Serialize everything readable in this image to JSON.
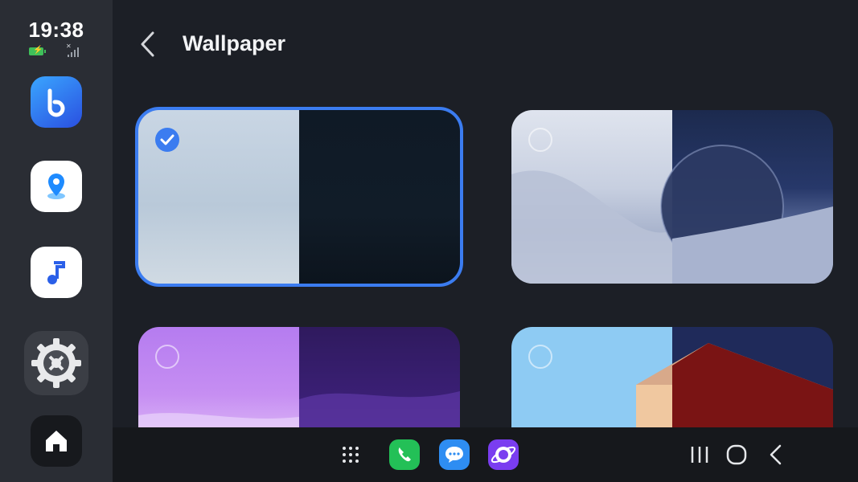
{
  "status_bar": {
    "time": "19:38"
  },
  "rail": {
    "apps": [
      {
        "name": "Bixby",
        "icon": "bixby-icon"
      },
      {
        "name": "Maps",
        "icon": "map-pin-icon"
      },
      {
        "name": "Music",
        "icon": "music-note-icon"
      },
      {
        "name": "Settings",
        "icon": "gear-icon"
      },
      {
        "name": "Home",
        "icon": "home-icon"
      }
    ]
  },
  "header": {
    "title": "Wallpaper",
    "back_icon": "chevron-left-icon"
  },
  "wallpapers": [
    {
      "selected": true
    },
    {
      "selected": false
    },
    {
      "selected": false
    },
    {
      "selected": false
    }
  ],
  "dock": {
    "left_icons": [
      "app-grid-icon",
      "phone-icon",
      "messages-icon",
      "internet-icon"
    ],
    "nav_icons": [
      "recents-icon",
      "home-circle-icon",
      "back-icon"
    ]
  },
  "colors": {
    "accent": "#3b7cf0",
    "background": "#1c1f26",
    "rail": "#2a2d34"
  }
}
